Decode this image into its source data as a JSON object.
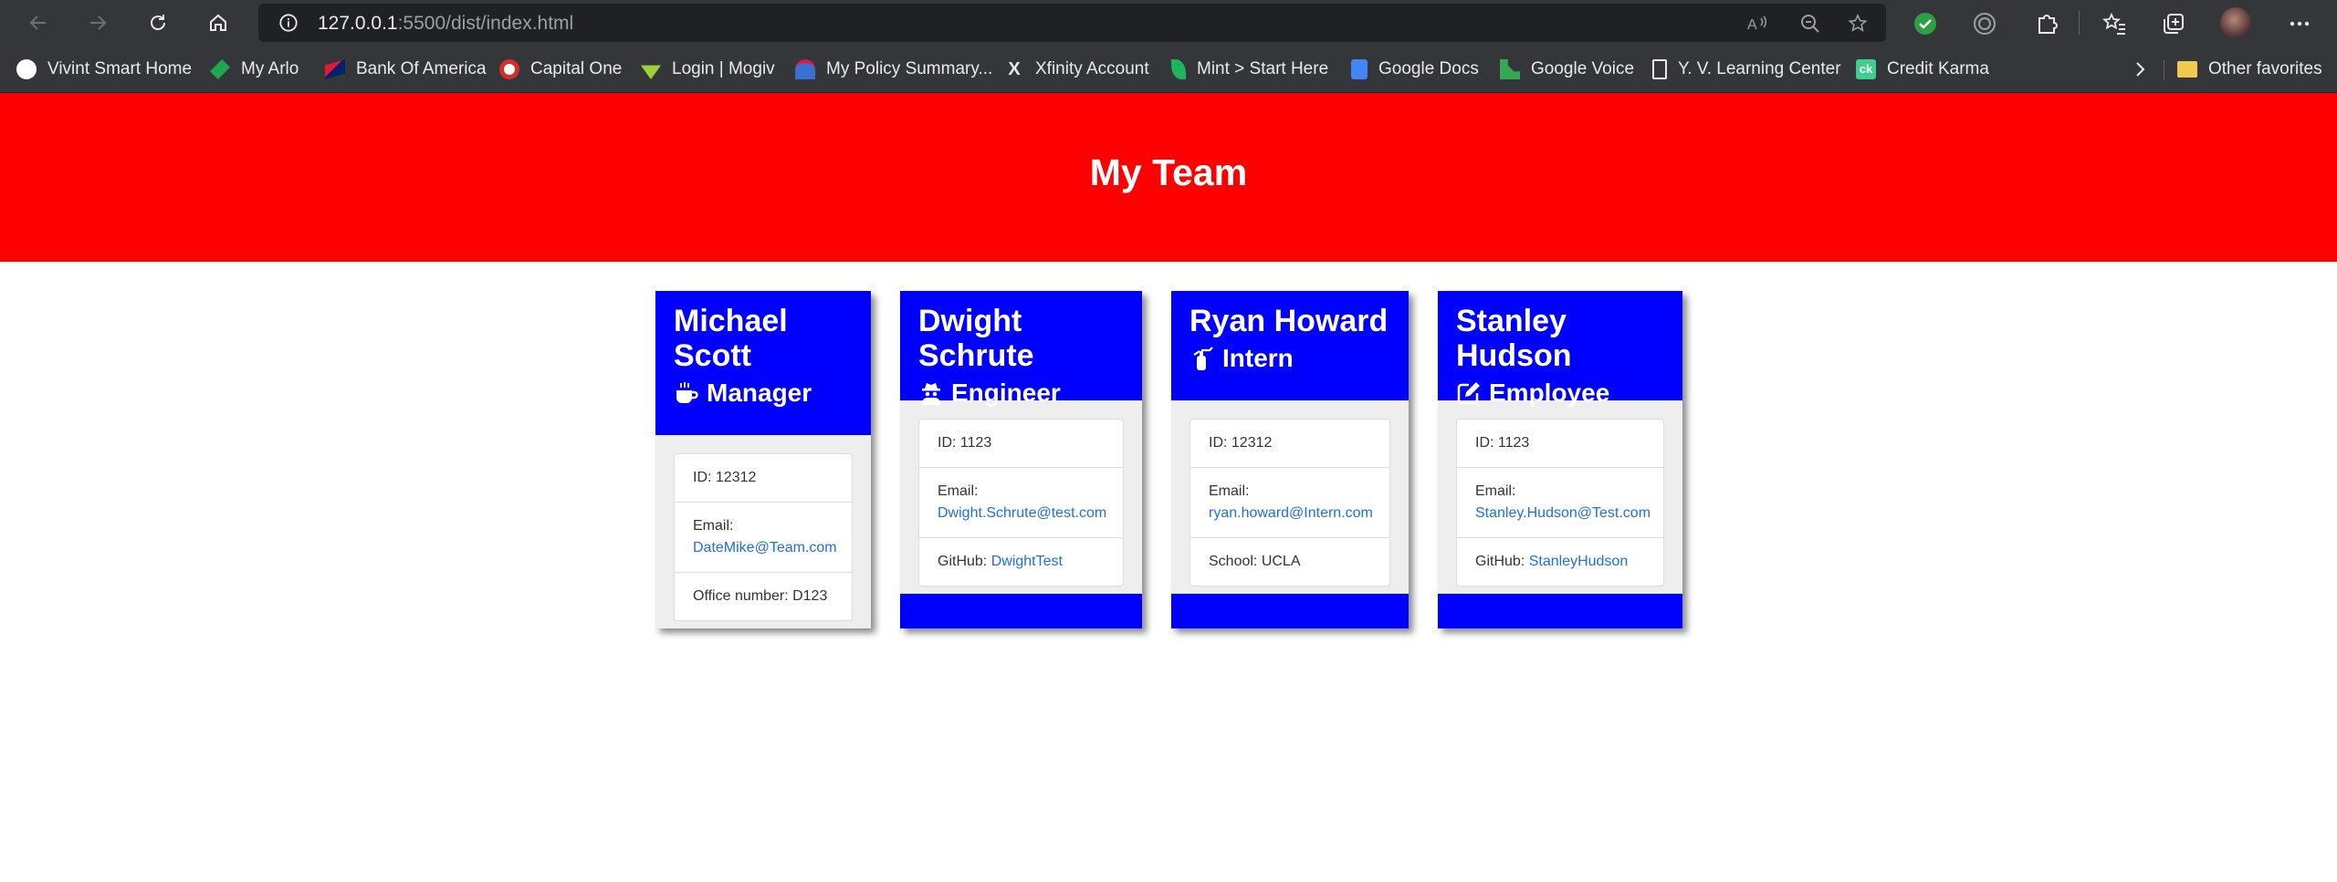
{
  "browser": {
    "url_host": "127.0.0.1",
    "url_rest": ":5500/dist/index.html",
    "bookmarks": [
      {
        "label": "Vivint Smart Home",
        "color": "#ffffff"
      },
      {
        "label": "My Arlo",
        "color": "#1fa84f"
      },
      {
        "label": "Bank Of America",
        "color": "#e31837"
      },
      {
        "label": "Capital One",
        "color": "#d03027"
      },
      {
        "label": "Login | Mogiv",
        "color": "#9bd13b"
      },
      {
        "label": "My Policy Summary...",
        "color": "#3b6fd1"
      },
      {
        "label": "Xfinity Account",
        "color": "#e8eaed"
      },
      {
        "label": "Mint > Start Here",
        "color": "#1fb35e"
      },
      {
        "label": "Google Docs",
        "color": "#4285f4"
      },
      {
        "label": "Google Voice",
        "color": "#34a853"
      },
      {
        "label": "Y. V. Learning Center",
        "color": "#e8eaed"
      },
      {
        "label": "Credit Karma",
        "color": "#3ecf8e"
      }
    ],
    "other_favorites": "Other favorites"
  },
  "page": {
    "title": "My Team",
    "colors": {
      "banner": "#ff0000",
      "card_header": "#0000ff",
      "link": "#1e6fe0"
    }
  },
  "team": [
    {
      "name": "Michael Scott",
      "role": "Manager",
      "role_icon": "mug-icon",
      "id_label": "ID: 12312",
      "email_label": "Email:",
      "email": "DateMike@Team.com",
      "extra_label": "Office number: D123",
      "extra_link": ""
    },
    {
      "name": "Dwight Schrute",
      "role": "Engineer",
      "role_icon": "user-secret-icon",
      "id_label": "ID: 1123",
      "email_label": "Email:",
      "email": "Dwight.Schrute@test.com",
      "extra_label": "GitHub:",
      "extra_link": "DwightTest"
    },
    {
      "name": "Ryan Howard",
      "role": "Intern",
      "role_icon": "fire-extinguisher-icon",
      "id_label": "ID: 12312",
      "email_label": "Email:",
      "email": "ryan.howard@Intern.com",
      "extra_label": "School: UCLA",
      "extra_link": ""
    },
    {
      "name": "Stanley Hudson",
      "role": "Employee",
      "role_icon": "edit-icon",
      "id_label": "ID: 1123",
      "email_label": "Email:",
      "email": "Stanley.Hudson@Test.com",
      "extra_label": "GitHub:",
      "extra_link": "StanleyHudson"
    }
  ]
}
